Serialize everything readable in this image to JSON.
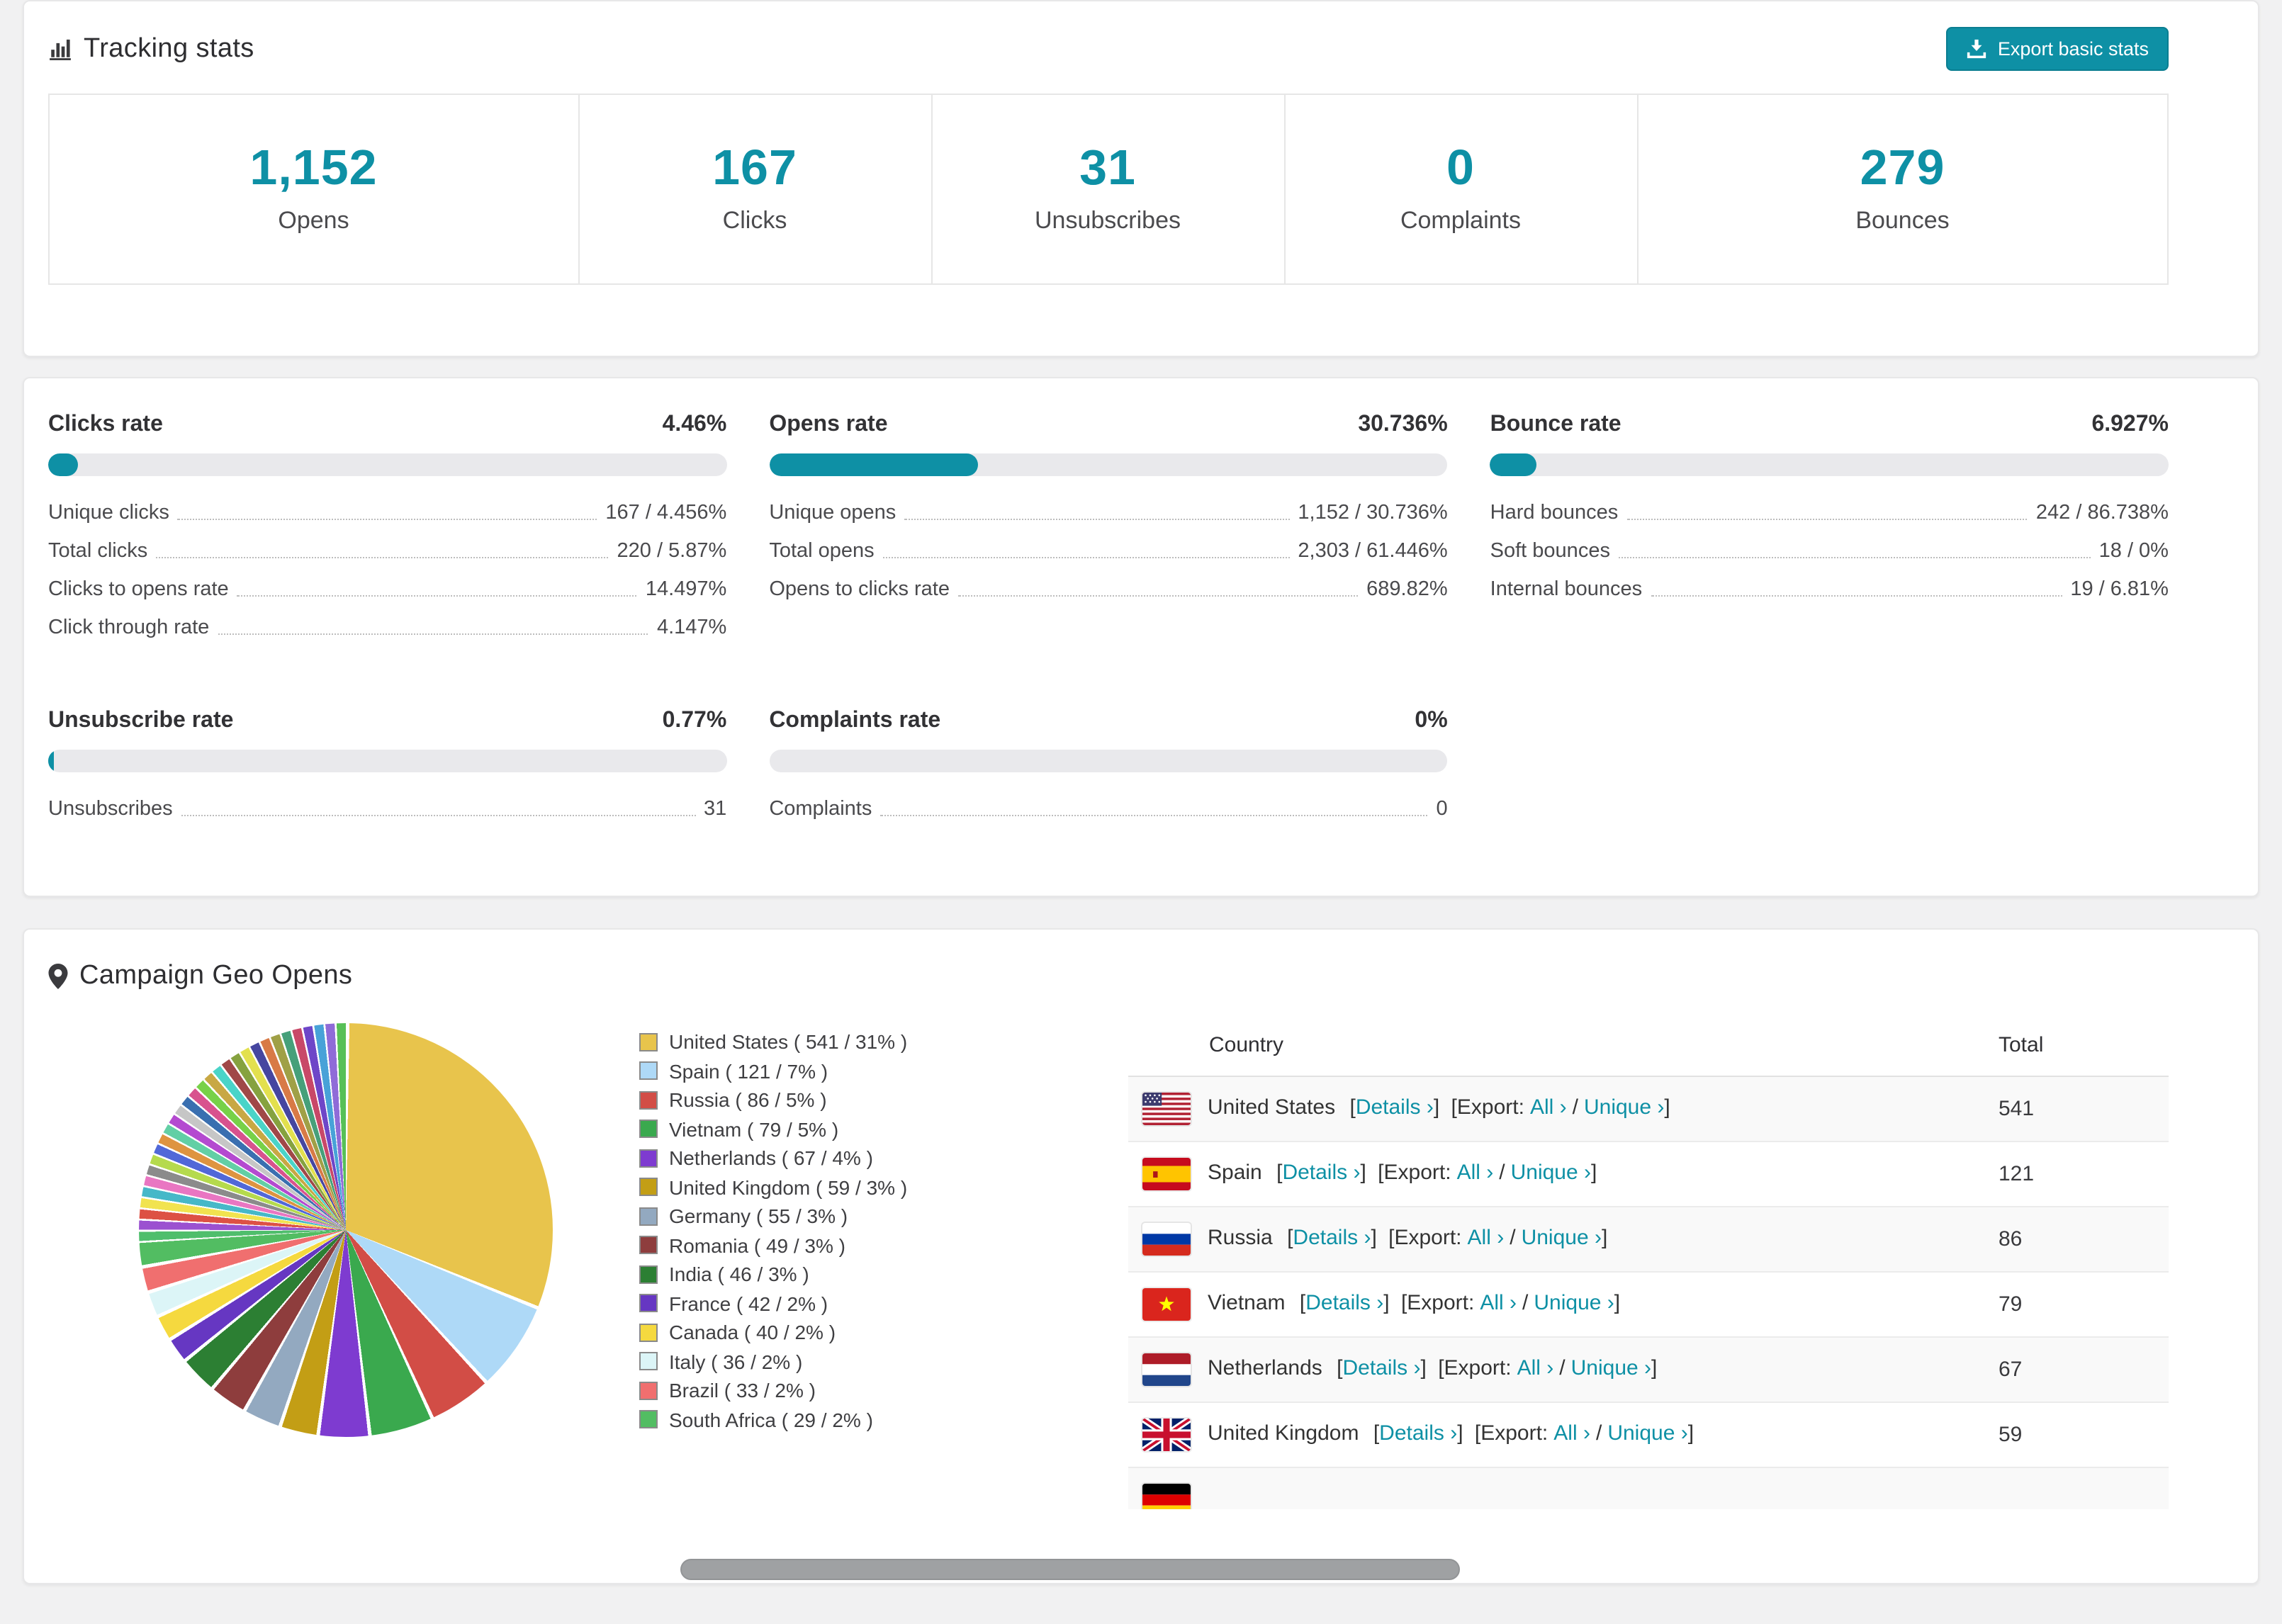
{
  "theme": {
    "accent": "#0e90a5",
    "accent_dark": "#0b7e91",
    "bar_track": "#e9e9ec"
  },
  "tracking": {
    "title": "Tracking stats",
    "export_button": "Export basic stats",
    "stats": [
      {
        "value": "1,152",
        "label": "Opens"
      },
      {
        "value": "167",
        "label": "Clicks"
      },
      {
        "value": "31",
        "label": "Unsubscribes"
      },
      {
        "value": "0",
        "label": "Complaints"
      },
      {
        "value": "279",
        "label": "Bounces"
      }
    ]
  },
  "rates": [
    {
      "title": "Clicks rate",
      "value": "4.46%",
      "pct": 4.46,
      "rows": [
        {
          "label": "Unique clicks",
          "value": "167 / 4.456%"
        },
        {
          "label": "Total clicks",
          "value": "220 / 5.87%"
        },
        {
          "label": "Clicks to opens rate",
          "value": "14.497%"
        },
        {
          "label": "Click through rate",
          "value": "4.147%"
        }
      ]
    },
    {
      "title": "Opens rate",
      "value": "30.736%",
      "pct": 30.736,
      "rows": [
        {
          "label": "Unique opens",
          "value": "1,152 / 30.736%"
        },
        {
          "label": "Total opens",
          "value": "2,303 / 61.446%"
        },
        {
          "label": "Opens to clicks rate",
          "value": "689.82%"
        }
      ]
    },
    {
      "title": "Bounce rate",
      "value": "6.927%",
      "pct": 6.927,
      "rows": [
        {
          "label": "Hard bounces",
          "value": "242 / 86.738%"
        },
        {
          "label": "Soft bounces",
          "value": "18 / 0%"
        },
        {
          "label": "Internal bounces",
          "value": "19 / 6.81%"
        }
      ]
    },
    {
      "title": "Unsubscribe rate",
      "value": "0.77%",
      "pct": 0.77,
      "rows": [
        {
          "label": "Unsubscribes",
          "value": "31"
        }
      ]
    },
    {
      "title": "Complaints rate",
      "value": "0%",
      "pct": 0,
      "rows": [
        {
          "label": "Complaints",
          "value": "0"
        }
      ]
    }
  ],
  "geo": {
    "title": "Campaign Geo Opens",
    "table": {
      "headers": {
        "country": "Country",
        "total": "Total"
      },
      "labels": {
        "lb": "[",
        "rb": "]",
        "details": "Details ›",
        "export": "Export:",
        "all": "All ›",
        "unique": "Unique ›",
        "slash": "/"
      },
      "rows": [
        {
          "country": "United States",
          "flag": "us",
          "total": "541"
        },
        {
          "country": "Spain",
          "flag": "es",
          "total": "121"
        },
        {
          "country": "Russia",
          "flag": "ru",
          "total": "86"
        },
        {
          "country": "Vietnam",
          "flag": "vn",
          "total": "79"
        },
        {
          "country": "Netherlands",
          "flag": "nl",
          "total": "67"
        },
        {
          "country": "United Kingdom",
          "flag": "gb",
          "total": "59"
        },
        {
          "country": "",
          "flag": "de",
          "total": ""
        }
      ]
    },
    "chart_data": {
      "type": "pie",
      "title": "Campaign Geo Opens",
      "slices": [
        {
          "label": "United States",
          "value": 541,
          "pct": 31,
          "color": "#e8c44c",
          "legend_label": "United States ( 541 / 31% )"
        },
        {
          "label": "Spain",
          "value": 121,
          "pct": 7,
          "color": "#aed9f7",
          "legend_label": "Spain ( 121 / 7% )"
        },
        {
          "label": "Russia",
          "value": 86,
          "pct": 5,
          "color": "#d24d46",
          "legend_label": "Russia ( 86 / 5% )"
        },
        {
          "label": "Vietnam",
          "value": 79,
          "pct": 5,
          "color": "#3aa94e",
          "legend_label": "Vietnam ( 79 / 5% )"
        },
        {
          "label": "Netherlands",
          "value": 67,
          "pct": 4,
          "color": "#7e3bd0",
          "legend_label": "Netherlands ( 67 / 4% )"
        },
        {
          "label": "United Kingdom",
          "value": 59,
          "pct": 3,
          "color": "#c39e15",
          "legend_label": "United Kingdom ( 59 / 3% )"
        },
        {
          "label": "Germany",
          "value": 55,
          "pct": 3,
          "color": "#93a9c0",
          "legend_label": "Germany ( 55 / 3% )"
        },
        {
          "label": "Romania",
          "value": 49,
          "pct": 3,
          "color": "#8e3d3d",
          "legend_label": "Romania ( 49 / 3% )"
        },
        {
          "label": "India",
          "value": 46,
          "pct": 3,
          "color": "#2c7f33",
          "legend_label": "India ( 46 / 3% )"
        },
        {
          "label": "France",
          "value": 42,
          "pct": 2,
          "color": "#6637c2",
          "legend_label": "France ( 42 / 2% )"
        },
        {
          "label": "Canada",
          "value": 40,
          "pct": 2,
          "color": "#f5d93f",
          "legend_label": "Canada ( 40 / 2% )"
        },
        {
          "label": "Italy",
          "value": 36,
          "pct": 2,
          "color": "#dcf5f7",
          "legend_label": "Italy ( 36 / 2% )"
        },
        {
          "label": "Brazil",
          "value": 33,
          "pct": 2,
          "color": "#f06f6f",
          "legend_label": "Brazil ( 33 / 2% )"
        },
        {
          "label": "South Africa",
          "value": 29,
          "pct": 2,
          "color": "#52bd62",
          "legend_label": "South Africa ( 29 / 2% )"
        }
      ],
      "others": {
        "pct": 26,
        "colors": [
          "#4fbe6c",
          "#9b51d0",
          "#dd5144",
          "#f1e34f",
          "#46b8c8",
          "#e976c2",
          "#8b8b8b",
          "#b5da4d",
          "#5168d8",
          "#de9440",
          "#62cfa5",
          "#b44ad0",
          "#c6c6c6",
          "#3a6fb0",
          "#d8528e",
          "#77d148",
          "#c8a844",
          "#4ad4c8",
          "#a04848",
          "#86a23f",
          "#e3e04e",
          "#4646a0",
          "#d87a46",
          "#a0a046",
          "#46a07a",
          "#c84868",
          "#6e46c8",
          "#48a2d8",
          "#8f6bd8",
          "#57c057"
        ]
      }
    }
  }
}
